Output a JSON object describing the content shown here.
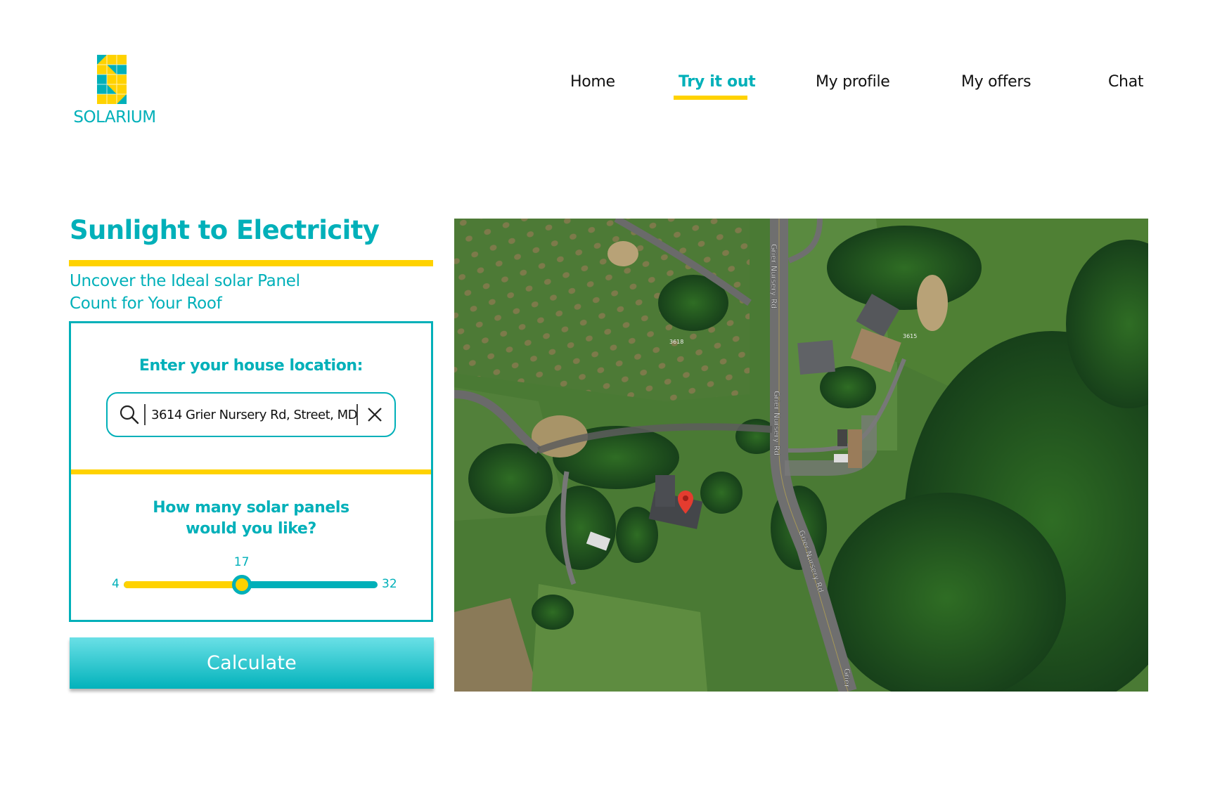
{
  "brand": {
    "name": "SOLARIUM",
    "logo_icon": "solar-panel-s-icon",
    "colors": {
      "teal": "#00b0b9",
      "yellow": "#ffd200"
    }
  },
  "nav": {
    "items": [
      {
        "label": "Home",
        "active": false
      },
      {
        "label": "Try it out",
        "active": true
      },
      {
        "label": "My profile",
        "active": false
      },
      {
        "label": "My offers",
        "active": false
      },
      {
        "label": "Chat",
        "active": false
      }
    ]
  },
  "hero": {
    "title": "Sunlight to Electricity",
    "subtitle_line1": "Uncover the Ideal solar Panel",
    "subtitle_line2": "Count for Your Roof"
  },
  "location": {
    "label": "Enter your house location:",
    "value": "3614 Grier Nursery Rd, Street, MD",
    "search_icon": "search-icon",
    "clear_icon": "close-icon"
  },
  "panels": {
    "label_line1": "How many solar panels",
    "label_line2": "would you like?",
    "min": 4,
    "max": 32,
    "value": 17
  },
  "actions": {
    "calculate_label": "Calculate"
  },
  "map": {
    "type": "satellite",
    "road_name": "Grier Nursery Rd",
    "road_label_partial": "Grier",
    "house_numbers": [
      "3618",
      "3615"
    ],
    "pin_icon": "map-pin-icon"
  }
}
